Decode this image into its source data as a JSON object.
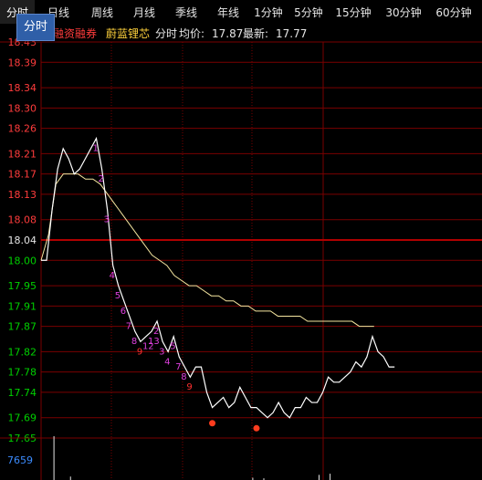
{
  "tabs": [
    {
      "label": "分时",
      "active": true
    },
    {
      "label": "日线",
      "active": false
    },
    {
      "label": "周线",
      "active": false
    },
    {
      "label": "月线",
      "active": false
    },
    {
      "label": "季线",
      "active": false
    },
    {
      "label": "年线",
      "active": false
    },
    {
      "label": "1分钟",
      "active": false
    },
    {
      "label": "5分钟",
      "active": false
    },
    {
      "label": "15分钟",
      "active": false
    },
    {
      "label": "30分钟",
      "active": false
    },
    {
      "label": "60分钟",
      "active": false
    }
  ],
  "tooltip": "分时",
  "info": {
    "margin_trading": "融资融券",
    "stock_name": "蔚蓝锂芯",
    "mode": "分时",
    "avg_label": "均价:",
    "avg_value": "17.87",
    "latest_label": "最新:",
    "latest_value": "17.77"
  },
  "colors": {
    "up": "#ff3c3c",
    "down": "#00d000",
    "grid": "#7a0000",
    "price_line": "#ffffff",
    "avg_line": "#f5e6a0",
    "seq": "#e040e0",
    "seq_9": "#ff3030"
  },
  "chart_data": {
    "type": "line",
    "reference_price": 18.04,
    "y_ticks": [
      "18.43",
      "18.39",
      "18.34",
      "18.30",
      "18.26",
      "18.21",
      "18.17",
      "18.13",
      "18.08",
      "18.04",
      "18.00",
      "17.95",
      "17.91",
      "17.87",
      "17.82",
      "17.78",
      "17.74",
      "17.69",
      "17.65"
    ],
    "y_tick_values": [
      18.43,
      18.39,
      18.34,
      18.3,
      18.26,
      18.21,
      18.17,
      18.13,
      18.08,
      18.04,
      18.0,
      17.95,
      17.91,
      17.87,
      17.82,
      17.78,
      17.74,
      17.69,
      17.65
    ],
    "ylim": [
      17.65,
      18.43
    ],
    "series": [
      {
        "role": "price",
        "values": [
          18.0,
          18.0,
          18.1,
          18.18,
          18.22,
          18.2,
          18.17,
          18.18,
          18.2,
          18.22,
          18.24,
          18.18,
          18.1,
          17.99,
          17.95,
          17.92,
          17.89,
          17.86,
          17.84,
          17.85,
          17.86,
          17.88,
          17.84,
          17.82,
          17.85,
          17.81,
          17.79,
          17.77,
          17.79,
          17.79,
          17.74,
          17.71,
          17.72,
          17.73,
          17.71,
          17.72,
          17.75,
          17.73,
          17.71,
          17.71,
          17.7,
          17.69,
          17.7,
          17.72,
          17.7,
          17.69,
          17.71,
          17.71,
          17.73,
          17.72,
          17.72,
          17.74,
          17.77,
          17.76,
          17.76,
          17.77,
          17.78,
          17.8,
          17.79,
          17.81,
          17.85,
          17.82,
          17.81,
          17.79,
          17.79
        ]
      },
      {
        "role": "average",
        "values": [
          18.0,
          18.05,
          18.15,
          18.17,
          18.17,
          18.17,
          18.16,
          18.16,
          18.15,
          18.13,
          18.11,
          18.09,
          18.07,
          18.05,
          18.03,
          18.01,
          18.0,
          17.99,
          17.97,
          17.96,
          17.95,
          17.95,
          17.94,
          17.93,
          17.93,
          17.92,
          17.92,
          17.91,
          17.91,
          17.9,
          17.9,
          17.9,
          17.89,
          17.89,
          17.89,
          17.89,
          17.88,
          17.88,
          17.88,
          17.88,
          17.88,
          17.88,
          17.88,
          17.87,
          17.87,
          17.87
        ]
      }
    ],
    "markers": [
      {
        "label": "1",
        "index": 10
      },
      {
        "label": "2",
        "index": 11
      },
      {
        "label": "3",
        "index": 12
      },
      {
        "label": "4",
        "index": 13
      },
      {
        "label": "5",
        "index": 14
      },
      {
        "label": "6",
        "index": 15
      },
      {
        "label": "7",
        "index": 16
      },
      {
        "label": "8",
        "index": 17
      },
      {
        "label": "9",
        "index": 18
      },
      {
        "label": "12",
        "index": 19
      },
      {
        "label": "13",
        "index": 20
      },
      {
        "label": "2",
        "index": 21
      },
      {
        "label": "3",
        "index": 22
      },
      {
        "label": "4",
        "index": 23
      },
      {
        "label": "5",
        "index": 24
      },
      {
        "label": "7",
        "index": 25
      },
      {
        "label": "8",
        "index": 26
      },
      {
        "label": "9",
        "index": 27
      }
    ],
    "volume": {
      "label": "7659",
      "bars": [
        {
          "index": 2,
          "value": 7659
        },
        {
          "index": 5,
          "value": 600
        },
        {
          "index": 38,
          "value": 400
        },
        {
          "index": 40,
          "value": 300
        },
        {
          "index": 50,
          "value": 900
        },
        {
          "index": 52,
          "value": 1100
        }
      ]
    }
  }
}
